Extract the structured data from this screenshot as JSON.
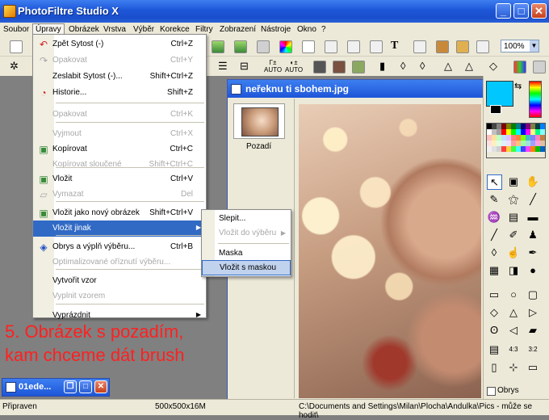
{
  "window": {
    "title": "PhotoFiltre Studio X"
  },
  "menubar": [
    "Soubor",
    "Úpravy",
    "Obrázek",
    "Vrstva",
    "Výběr",
    "Korekce",
    "Filtry",
    "Zobrazení",
    "Nástroje",
    "Okno",
    "?"
  ],
  "zoom": "100%",
  "edit_menu": {
    "items": [
      {
        "label": "Zpět Sytost (-)",
        "shortcut": "Ctrl+Z",
        "disabled": false,
        "icon": "undo-icon"
      },
      {
        "label": "Opakovat",
        "shortcut": "Ctrl+Y",
        "disabled": true,
        "icon": "redo-icon"
      },
      {
        "label": "Zeslabit Sytost (-)...",
        "shortcut": "Shift+Ctrl+Z",
        "disabled": false
      },
      {
        "label": "Historie...",
        "shortcut": "Shift+Z",
        "disabled": false,
        "icon": "history-icon"
      },
      {
        "label": "Opakovat",
        "shortcut": "Ctrl+K",
        "disabled": true
      },
      {
        "label": "Vyjmout",
        "shortcut": "Ctrl+X",
        "disabled": true
      },
      {
        "label": "Kopírovat",
        "shortcut": "Ctrl+C",
        "disabled": false,
        "icon": "copy-icon"
      },
      {
        "label": "Kopírovat sloučené",
        "shortcut": "Shift+Ctrl+C",
        "disabled": true
      },
      {
        "label": "Vložit",
        "shortcut": "Ctrl+V",
        "disabled": false,
        "icon": "paste-icon"
      },
      {
        "label": "Vymazat",
        "shortcut": "Del",
        "disabled": true,
        "icon": "eraser-icon"
      },
      {
        "label": "Vložit jako nový obrázek",
        "shortcut": "Shift+Ctrl+V",
        "disabled": false,
        "icon": "paste-new-icon"
      },
      {
        "label": "Vložit jinak",
        "shortcut": "",
        "disabled": false,
        "submenu": true
      },
      {
        "label": "Obrys a výplň výběru...",
        "shortcut": "Ctrl+B",
        "disabled": false,
        "icon": "fill-icon"
      },
      {
        "label": "Optimalizované oříznutí výběru...",
        "shortcut": "",
        "disabled": true
      },
      {
        "label": "Vytvořit vzor",
        "shortcut": "",
        "disabled": false
      },
      {
        "label": "Vyplnit vzorem",
        "shortcut": "",
        "disabled": true
      },
      {
        "label": "Vyprázdnit",
        "shortcut": "",
        "disabled": false,
        "submenu": true
      }
    ]
  },
  "paste_submenu": [
    {
      "label": "Slepit...",
      "disabled": false
    },
    {
      "label": "Vložit do výběru",
      "disabled": true,
      "submenu": true
    },
    {
      "label": "Maska",
      "disabled": false
    },
    {
      "label": "Vložit s maskou",
      "disabled": false
    }
  ],
  "image_window": {
    "title": "neřeknu ti sbohem.jpg",
    "layer_name": "Pozadí"
  },
  "caption": [
    "5. Obrázek s pozadím,",
    "kam chceme dát brush"
  ],
  "minimized_window": {
    "title": "01ede..."
  },
  "right_panel": {
    "outline_label": "Obrys",
    "fg_color": "#00c8ff",
    "bg_color": "#000000"
  },
  "status": {
    "state": "Připraven",
    "size": "500x500x16M",
    "path": "C:\\Documents and Settings\\Milan\\Plocha\\Andulka\\Pics - může se hodit\\"
  }
}
